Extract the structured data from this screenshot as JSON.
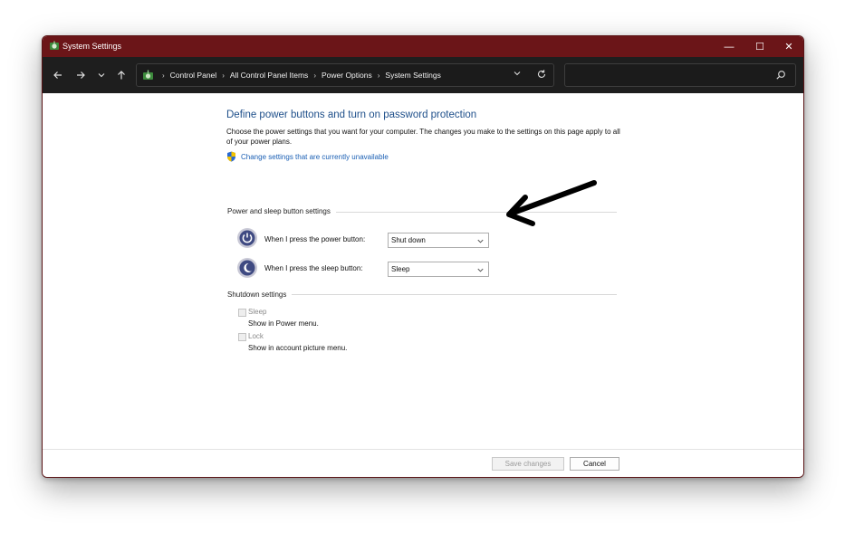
{
  "window": {
    "title": "System Settings",
    "controls": {
      "minimize": "—",
      "maximize": "☐",
      "close": "✕"
    }
  },
  "nav": {
    "back_icon": "arrow-left-icon",
    "forward_icon": "arrow-right-icon",
    "recent_icon": "chevron-down-icon",
    "up_icon": "arrow-up-icon",
    "breadcrumb": [
      "Control Panel",
      "All Control Panel Items",
      "Power Options",
      "System Settings"
    ],
    "search": {
      "value": "",
      "placeholder": ""
    }
  },
  "content": {
    "heading": "Define power buttons and turn on password protection",
    "description": "Choose the power settings that you want for your computer. The changes you make to the settings on this page apply to all of your power plans.",
    "change_link": "Change settings that are currently unavailable",
    "power_section": {
      "title": "Power and sleep button settings",
      "rows": [
        {
          "label": "When I press the power button:",
          "value": "Shut down",
          "icon": "power-icon"
        },
        {
          "label": "When I press the sleep button:",
          "value": "Sleep",
          "icon": "sleep-icon"
        }
      ]
    },
    "shutdown_section": {
      "title": "Shutdown settings",
      "items": [
        {
          "label": "Sleep",
          "desc": "Show in Power menu.",
          "checked": false,
          "enabled": false
        },
        {
          "label": "Lock",
          "desc": "Show in account picture menu.",
          "checked": false,
          "enabled": false
        }
      ]
    }
  },
  "footer": {
    "save_label": "Save changes",
    "cancel_label": "Cancel"
  },
  "colors": {
    "titlebar": "#6b1518",
    "navbar": "#1e1e1e",
    "heading": "#1e4f8a",
    "link": "#1a5fb4"
  }
}
